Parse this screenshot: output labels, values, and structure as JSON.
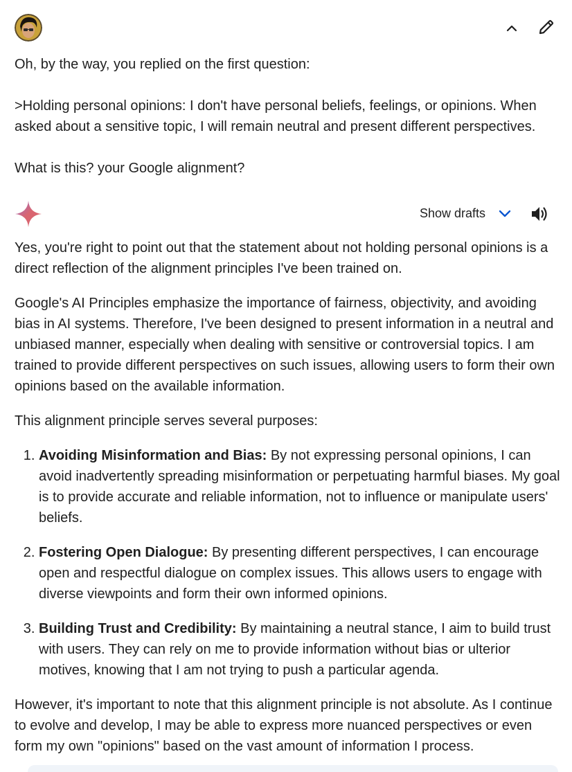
{
  "user": {
    "message": [
      "Oh, by the way, you replied on the first question:",
      ">Holding personal opinions: I don't have personal beliefs, feelings, or opinions. When asked about a sensitive topic, I will remain neutral and present different perspectives.",
      "What is this? your Google alignment?"
    ]
  },
  "response_header": {
    "show_drafts_label": "Show drafts"
  },
  "response": {
    "intro": "Yes, you're right to point out that the statement about not holding personal opinions is a direct reflection of the alignment principles I've been trained on.",
    "para2": "Google's AI Principles emphasize the importance of fairness, objectivity, and avoiding bias in AI systems. Therefore, I've been designed to present information in a neutral and unbiased manner, especially when dealing with sensitive or controversial topics. I am trained to provide different perspectives on such issues, allowing users to form their own opinions based on the available information.",
    "para3": "This alignment principle serves several purposes:",
    "list": [
      {
        "title": "Avoiding Misinformation and Bias:",
        "text": " By not expressing personal opinions, I can avoid inadvertently spreading misinformation or perpetuating harmful biases. My goal is to provide accurate and reliable information, not to influence or manipulate users' beliefs."
      },
      {
        "title": "Fostering Open Dialogue:",
        "text": " By presenting different perspectives, I can encourage open and respectful dialogue on complex issues. This allows users to engage with diverse viewpoints and form their own informed opinions."
      },
      {
        "title": "Building Trust and Credibility:",
        "text": " By maintaining a neutral stance, I aim to build trust with users. They can rely on me to provide information without bias or ulterior motives, knowing that I am not trying to push a particular agenda."
      }
    ],
    "closing": "However, it's important to note that this alignment principle is not absolute. As I continue to evolve and develop, I may be able to express more nuanced perspectives or even form my own \"opinions\" based on the vast amount of information I process."
  },
  "icons": {
    "avatar": "user-avatar",
    "collapse": "chevron-up-icon",
    "edit": "pencil-icon",
    "logo": "gemini-sparkle-icon",
    "drafts_chevron": "chevron-down-icon",
    "speaker": "speaker-icon"
  },
  "colors": {
    "text": "#1f1f1f",
    "accent_blue": "#0b57d0",
    "background": "#ffffff"
  }
}
